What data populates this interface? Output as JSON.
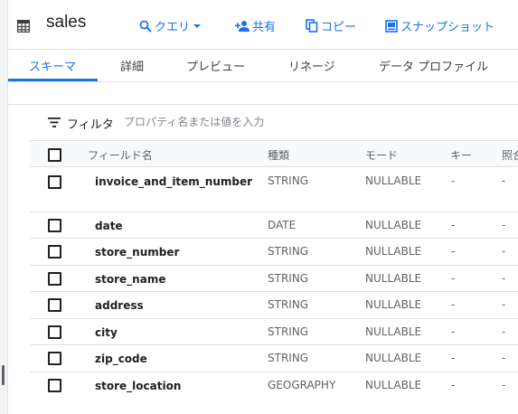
{
  "header": {
    "title": "sales",
    "toolbar": {
      "query_label": "クエリ",
      "share_label": "共有",
      "copy_label": "コピー",
      "snapshot_label": "スナップショット"
    }
  },
  "tabs": [
    {
      "label": "スキーマ",
      "active": true
    },
    {
      "label": "詳細",
      "active": false
    },
    {
      "label": "プレビュー",
      "active": false
    },
    {
      "label": "リネージ",
      "active": false
    },
    {
      "label": "データ プロファイル",
      "active": false
    }
  ],
  "filter": {
    "label": "フィルタ",
    "placeholder": "プロパティ名または値を入力"
  },
  "schema": {
    "columns": [
      "フィールド名",
      "種類",
      "モード",
      "キー",
      "照合"
    ],
    "rows": [
      {
        "name": "invoice_and_item_number",
        "type": "STRING",
        "mode": "NULLABLE",
        "key": "-",
        "collation": "-"
      },
      {
        "name": "date",
        "type": "DATE",
        "mode": "NULLABLE",
        "key": "-",
        "collation": "-"
      },
      {
        "name": "store_number",
        "type": "STRING",
        "mode": "NULLABLE",
        "key": "-",
        "collation": "-"
      },
      {
        "name": "store_name",
        "type": "STRING",
        "mode": "NULLABLE",
        "key": "-",
        "collation": "-"
      },
      {
        "name": "address",
        "type": "STRING",
        "mode": "NULLABLE",
        "key": "-",
        "collation": "-"
      },
      {
        "name": "city",
        "type": "STRING",
        "mode": "NULLABLE",
        "key": "-",
        "collation": "-"
      },
      {
        "name": "zip_code",
        "type": "STRING",
        "mode": "NULLABLE",
        "key": "-",
        "collation": "-"
      },
      {
        "name": "store_location",
        "type": "GEOGRAPHY",
        "mode": "NULLABLE",
        "key": "-",
        "collation": "-"
      }
    ]
  },
  "colors": {
    "accent": "#1a73e8",
    "text": "#202124",
    "secondary_text": "#5f6368",
    "divider": "#e0e0e0"
  },
  "icons": [
    "table-icon",
    "search-icon",
    "chevron-down-icon",
    "person-add-icon",
    "copy-icon",
    "snapshot-icon",
    "filter-icon",
    "checkbox-icon"
  ]
}
